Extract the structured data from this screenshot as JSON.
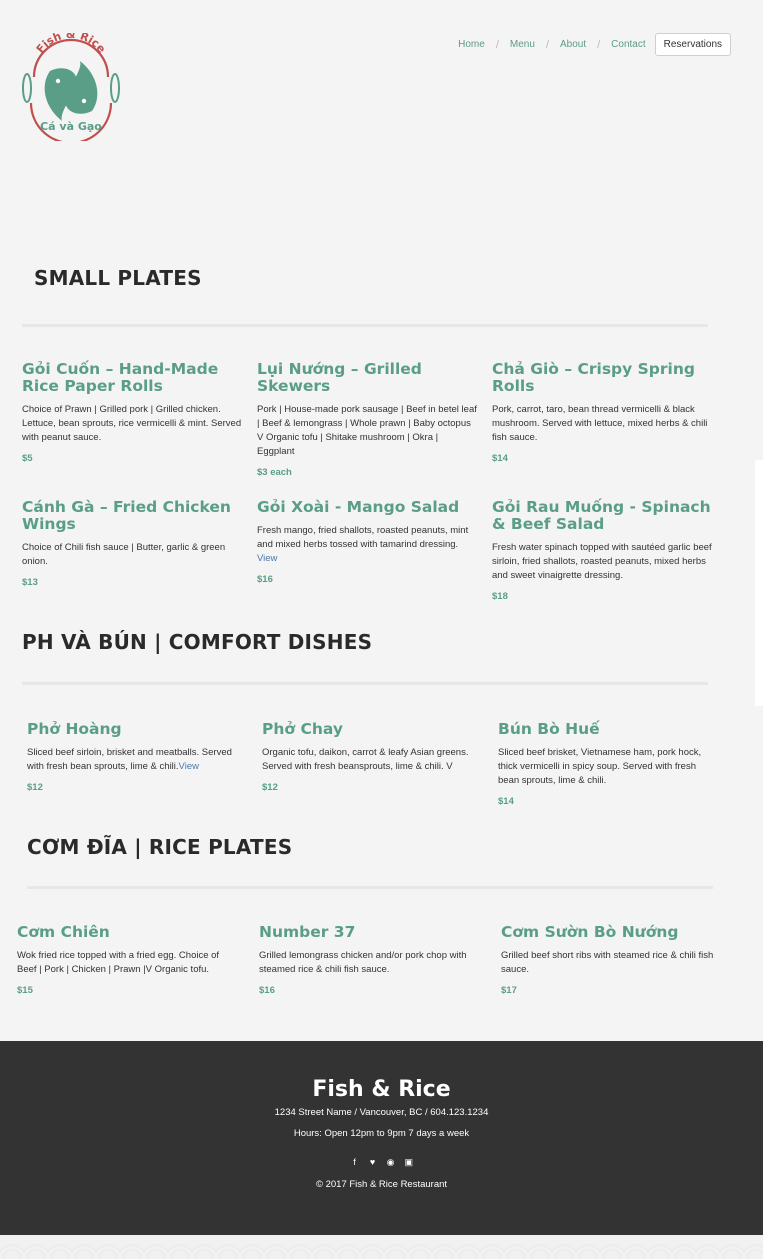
{
  "brand": {
    "logo_top_text": "Fish & Rice",
    "logo_bottom_text": "Cá và Gạo",
    "primary_color": "#5a9e87",
    "accent_color": "#c0504d"
  },
  "nav": {
    "items": [
      "Home",
      "Menu",
      "About",
      "Contact"
    ],
    "reservations_label": "Reservations"
  },
  "sections": [
    {
      "title": "SMALL PLATES",
      "items": [
        {
          "name": "Gỏi Cuốn – Hand-Made Rice Paper Rolls",
          "desc": "Choice of Prawn | Grilled pork | Grilled chicken. Lettuce, bean sprouts, rice vermicelli & mint. Served with peanut sauce.",
          "link": "",
          "price": "$5"
        },
        {
          "name": "Lụi Nướng – Grilled Skewers",
          "desc": "Pork | House-made pork sausage | Beef in betel leaf | Beef & lemongrass | Whole prawn | Baby octopus V Organic tofu | Shitake mushroom | Okra | Eggplant",
          "link": "",
          "price": "$3 each"
        },
        {
          "name": "Chả Giò – Crispy Spring Rolls",
          "desc": "Pork, carrot, taro, bean thread vermicelli & black mushroom. Served with lettuce, mixed herbs & chili fish sauce.",
          "link": "",
          "price": "$14"
        },
        {
          "name": "Cánh Gà – Fried Chicken Wings",
          "desc": "Choice of Chili fish sauce | Butter, garlic & green onion.",
          "link": "",
          "price": "$13"
        },
        {
          "name": "Gỏi Xoài - Mango Salad",
          "desc": "Fresh mango, fried shallots, roasted peanuts, mint and mixed herbs tossed with tamarind dressing.",
          "link": "View",
          "price": "$16"
        },
        {
          "name": "Gỏi Rau Muống - Spinach & Beef Salad",
          "desc": "Fresh water spinach topped with sautéed garlic beef sirloin, fried shallots, roasted peanuts, mixed herbs and sweet vinaigrette dressing.",
          "link": "",
          "price": "$18"
        }
      ]
    },
    {
      "title": "PH VÀ BÚN | COMFORT DISHES",
      "items": [
        {
          "name": "Phở Hoàng",
          "desc": "Sliced beef sirloin, brisket and meatballs. Served with fresh bean sprouts, lime & chili.",
          "link": "View",
          "price": "$12"
        },
        {
          "name": "Phở Chay",
          "desc": "Organic tofu, daikon, carrot & leafy Asian greens. Served with fresh beansprouts, lime & chili. V",
          "link": "",
          "price": "$12"
        },
        {
          "name": "Bún Bò Huế",
          "desc": "Sliced beef brisket, Vietnamese ham, pork hock, thick vermicelli in spicy soup. Served with fresh bean sprouts, lime & chili.",
          "link": "",
          "price": "$14"
        }
      ]
    },
    {
      "title": "CƠM ĐĨA | RICE PLATES",
      "items": [
        {
          "name": "Cơm Chiên",
          "desc": "Wok fried rice topped with a fried egg. Choice of Beef | Pork | Chicken | Prawn |V Organic tofu.",
          "link": "",
          "price": "$15"
        },
        {
          "name": "Number 37",
          "desc": "Grilled lemongrass chicken and/or pork chop with steamed rice & chili fish sauce.",
          "link": "",
          "price": "$16"
        },
        {
          "name": "Cơm Sườn Bò Nướng",
          "desc": "Grilled beef short ribs with steamed rice & chili fish sauce.",
          "link": "",
          "price": "$17"
        }
      ]
    }
  ],
  "footer": {
    "brand": "Fish & Rice",
    "address": "1234 Street Name / Vancouver, BC / 604.123.1234",
    "hours": "Hours: Open 12pm to 9pm 7 days a week",
    "social_icons": [
      "facebook-icon",
      "twitter-icon",
      "pinterest-icon",
      "instagram-icon"
    ],
    "copyright": "© 2017 Fish & Rice Restaurant"
  }
}
